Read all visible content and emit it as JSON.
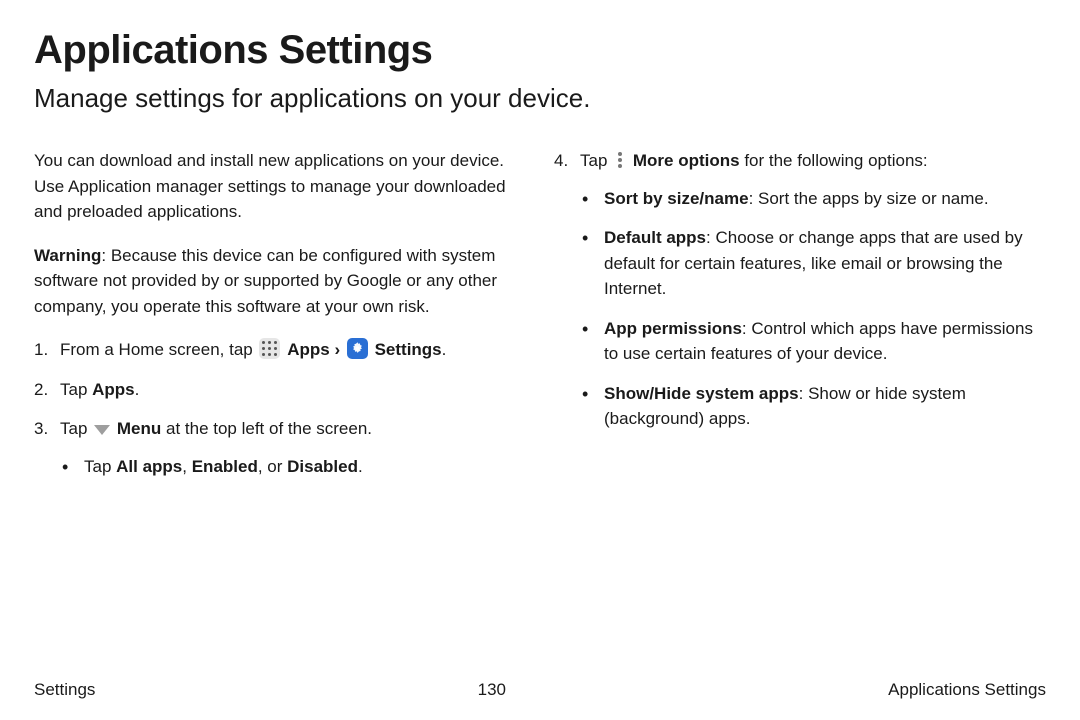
{
  "title": "Applications Settings",
  "subtitle": "Manage settings for applications on your device.",
  "intro": "You can download and install new applications on your device. Use Application manager settings to manage your downloaded and preloaded applications.",
  "warning_label": "Warning",
  "warning_text": ": Because this device can be configured with system software not provided by or supported by Google or any other company, you operate this software at your own risk.",
  "step1_a": "From a Home screen, tap ",
  "step1_apps": " Apps ",
  "step1_settings": " Settings",
  "step1_end": ".",
  "step2_a": "Tap ",
  "step2_b": "Apps",
  "step2_c": ".",
  "step3_a": "Tap ",
  "step3_b": " Menu",
  "step3_c": " at the top left of the screen.",
  "step3_sub_a": "Tap ",
  "step3_sub_b": "All apps",
  "step3_sub_c": ", ",
  "step3_sub_d": "Enabled",
  "step3_sub_e": ", or ",
  "step3_sub_f": "Disabled",
  "step3_sub_g": ".",
  "step4_a": "Tap ",
  "step4_b": " More options",
  "step4_c": " for the following options:",
  "opt1_b": "Sort by size/name",
  "opt1_t": ": Sort the apps by size or name.",
  "opt2_b": "Default apps",
  "opt2_t": ": Choose or change apps that are used by default for certain features, like email or browsing the Internet.",
  "opt3_b": "App permissions",
  "opt3_t": ": Control which apps have permissions to use certain features of your device.",
  "opt4_b": "Show/Hide system apps",
  "opt4_t": ": Show or hide system (background) apps.",
  "chevron": "›",
  "footer_left": "Settings",
  "footer_page": "130",
  "footer_right": "Applications Settings"
}
